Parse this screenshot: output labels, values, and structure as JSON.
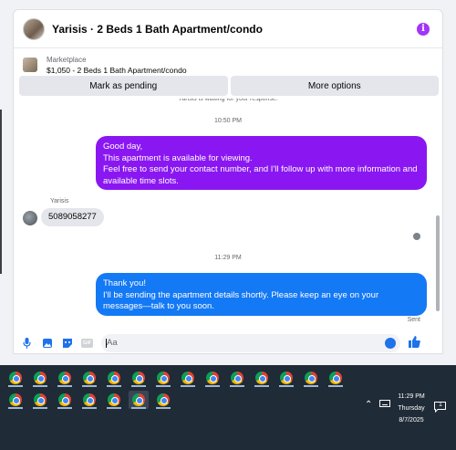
{
  "header": {
    "title": "Yarisis · 2 Beds 1 Bath Apartment/condo",
    "info_icon": "info-icon"
  },
  "marketplace": {
    "label": "Marketplace",
    "listing": "$1,050 - 2 Beds 1 Bath Apartment/condo"
  },
  "actions": {
    "mark_pending": "Mark as pending",
    "more_options": "More options"
  },
  "messages": {
    "cut_notice": "Yarisis is waiting for your response.",
    "timestamp1": "10:50 PM",
    "outgoing1": "Good day,\nThis apartment is available for viewing.\nFeel free to send your contact number, and I'll follow up with more information and available time slots.",
    "sender_name": "Yarisis",
    "incoming1": "5089058277",
    "timestamp2": "11:29 PM",
    "outgoing2": "Thank you!\nI'll be sending the apartment details shortly. Please keep an eye on your messages—talk to you soon.",
    "status": "Sent"
  },
  "input": {
    "placeholder": "Aa",
    "icons": [
      "microphone-icon",
      "photo-icon",
      "sticker-icon",
      "gif-icon",
      "emoji-icon",
      "like-icon"
    ],
    "gif_label": "GIF"
  },
  "colors": {
    "outgoing_purple": "#8a17f2",
    "outgoing_blue": "#1479f5",
    "accent": "#1e72ea"
  },
  "taskbar": {
    "row1_count": 14,
    "row2_count": 7,
    "app_icon": "chrome-icon",
    "clock_time": "11:29 PM",
    "clock_day": "Thursday",
    "clock_date": "8/7/2025",
    "tray_icons": [
      "chevron-up-icon",
      "keyboard-icon",
      "notification-icon"
    ],
    "notification_count": "1"
  }
}
